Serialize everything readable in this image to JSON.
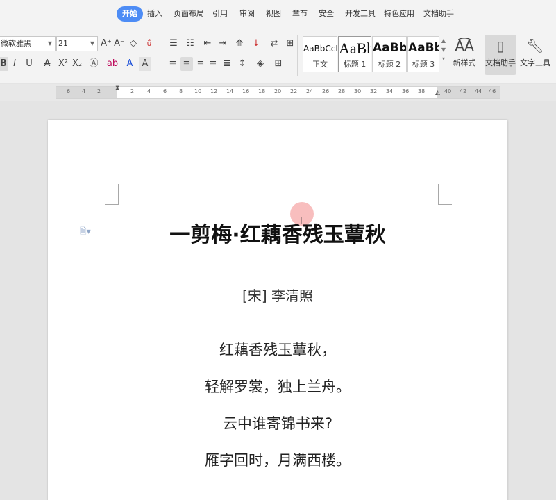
{
  "menu": {
    "tabs": [
      "开始",
      "插入",
      "页面布局",
      "引用",
      "审阅",
      "视图",
      "章节",
      "安全",
      "开发工具",
      "特色应用",
      "文档助手"
    ],
    "active_tab": "开始"
  },
  "ribbon": {
    "font_name": "微软雅黑",
    "font_size": "21",
    "styles": [
      {
        "sample": "AaBbCcD",
        "label": "正文"
      },
      {
        "sample": "AaBb",
        "label": "标题 1"
      },
      {
        "sample": "AaBb(",
        "label": "标题 2"
      },
      {
        "sample": "AaBb(",
        "label": "标题 3"
      }
    ],
    "new_style_label": "新样式",
    "doc_assistant_label": "文档助手",
    "text_tools_label": "文字工具",
    "accent_color": "#4d8cf5"
  },
  "ruler": {
    "numbers": [
      "6",
      "4",
      "2",
      "2",
      "4",
      "6",
      "8",
      "10",
      "12",
      "14",
      "16",
      "18",
      "20",
      "22",
      "24",
      "26",
      "28",
      "30",
      "32",
      "34",
      "36",
      "38",
      "40",
      "42",
      "44",
      "46"
    ]
  },
  "document": {
    "title": "一剪梅·红藕香残玉蕈秋",
    "author": "[宋] 李清照",
    "lines": [
      "红藕香残玉蕈秋，",
      "轻解罗裳，独上兰舟。",
      "云中谁寄锦书来?",
      "雁字回时，月满西楼。"
    ]
  }
}
